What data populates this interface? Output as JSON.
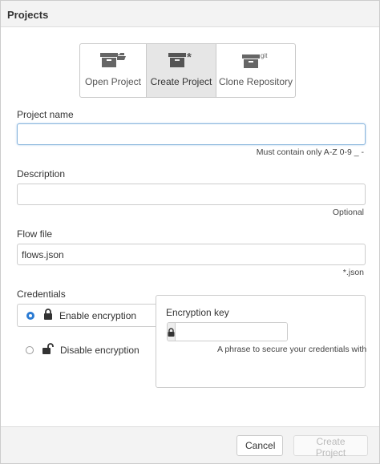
{
  "dialog": {
    "title": "Projects"
  },
  "modes": [
    {
      "label": "Open Project",
      "icon": "folder-box-icon"
    },
    {
      "label": "Create Project",
      "icon": "box-asterisk-icon",
      "selected": true
    },
    {
      "label": "Clone Repository",
      "icon": "box-git-icon",
      "icon_text": "git"
    }
  ],
  "project_name": {
    "label": "Project name",
    "value": "",
    "hint": "Must contain only A-Z 0-9 _ -"
  },
  "description": {
    "label": "Description",
    "value": "",
    "hint": "Optional"
  },
  "flow_file": {
    "label": "Flow file",
    "value": "flows.json",
    "hint": "*.json"
  },
  "credentials": {
    "label": "Credentials",
    "enable_label": "Enable encryption",
    "disable_label": "Disable encryption",
    "selected": "enable",
    "key_label": "Encryption key",
    "key_value": "",
    "key_hint": "A phrase to secure your credentials with"
  },
  "footer": {
    "cancel_label": "Cancel",
    "create_label": "Create Project"
  },
  "colors": {
    "accent": "#2b7bd3",
    "icon": "#666666",
    "selected_tab": "#e6e6e6"
  }
}
